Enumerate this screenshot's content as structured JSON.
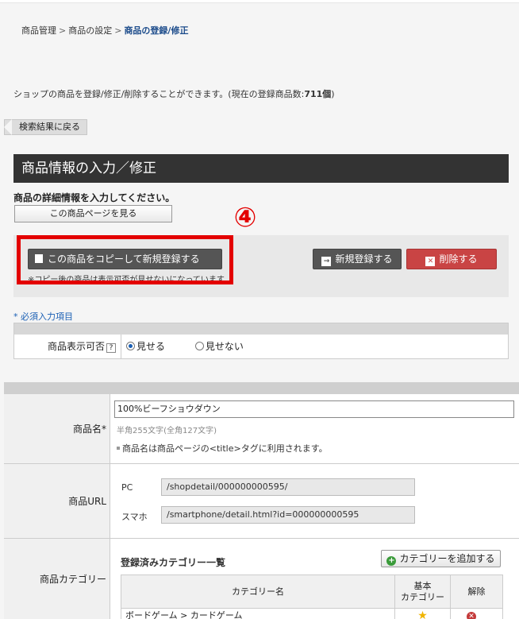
{
  "breadcrumb": {
    "item1": "商品管理",
    "item2": "商品の設定",
    "current": "商品の登録/修正",
    "sep": ">"
  },
  "description": {
    "text": "ショップの商品を登録/修正/削除することができます。(現在の登録商品数:",
    "count": "711個",
    "close": ")"
  },
  "back_button": "検索結果に戻る",
  "section_title": "商品情報の入力／修正",
  "lead_text": "商品の詳細情報を入力してください。",
  "view_page_button": "この商品ページを見る",
  "annotation_number": "④",
  "actions": {
    "copy_button": "この商品をコピーして新規登録する",
    "copy_note": "※コピー後の商品は表示可否が見せないになっています",
    "new_button": "新規登録する",
    "delete_button": "削除する",
    "colors": {
      "highlight": "#e30000",
      "delete": "#c94444",
      "dark_button": "#555555"
    }
  },
  "required_note": "* 必須入力項目",
  "display_setting": {
    "label": "商品表示可否",
    "help": "?",
    "options": [
      {
        "label": "見せる",
        "selected": true
      },
      {
        "label": "見せない",
        "selected": false
      }
    ]
  },
  "product_name": {
    "label": "商品名*",
    "value": "100%ビーフショウダウン",
    "hint": "半角255文字(全角127文字)",
    "note": "商品名は商品ページの<title>タグに利用されます。"
  },
  "product_url": {
    "label": "商品URL",
    "pc_label": "PC",
    "pc_value": "/shopdetail/000000000595/",
    "sp_label": "スマホ",
    "sp_value": "/smartphone/detail.html?id=000000000595"
  },
  "category": {
    "label": "商品カテゴリー",
    "list_title": "登録済みカテゴリー一覧",
    "add_button": "カテゴリーを追加する",
    "columns": [
      "カテゴリー名",
      "基本\nカテゴリー",
      "解除"
    ],
    "rows": [
      {
        "name": "ボードゲーム > カードゲーム"
      }
    ]
  }
}
